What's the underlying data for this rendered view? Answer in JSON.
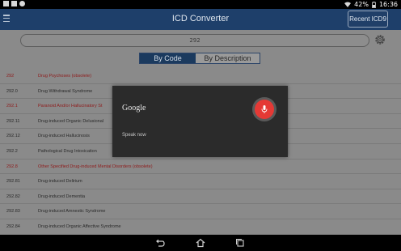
{
  "status_bar": {
    "battery": "42%",
    "time": "16:36",
    "icons": [
      "usb-icon",
      "notification-icon",
      "android-icon",
      "wifi-icon",
      "battery-icon"
    ]
  },
  "app_bar": {
    "title": "ICD Converter",
    "recent_button": "Recent ICD9",
    "menu_icon": "menu-icon"
  },
  "search": {
    "value": "292"
  },
  "tabs": [
    {
      "label": "By Code",
      "active": true
    },
    {
      "label": "By Description",
      "active": false
    }
  ],
  "rows": [
    {
      "code": "292",
      "desc": "Drug Psychoses  (obsolete)",
      "obsolete": true
    },
    {
      "code": "292.0",
      "desc": "Drug Withdrawal Syndrome",
      "obsolete": false
    },
    {
      "code": "292.1",
      "desc": "Paranoid And/or Hallucinatory St",
      "obsolete": true
    },
    {
      "code": "292.11",
      "desc": "Drug-induced Organic Delusional",
      "obsolete": false
    },
    {
      "code": "292.12",
      "desc": "Drug-induced Hallucinosis",
      "obsolete": false
    },
    {
      "code": "292.2",
      "desc": "Pathological Drug Intoxication",
      "obsolete": false
    },
    {
      "code": "292.8",
      "desc": "Other Specified Drug-induced Mental Disorders  (obsolete)",
      "obsolete": true
    },
    {
      "code": "292.81",
      "desc": "Drug-induced Delirium",
      "obsolete": false
    },
    {
      "code": "292.82",
      "desc": "Drug-induced Dementia",
      "obsolete": false
    },
    {
      "code": "292.83",
      "desc": "Drug-induced Amnestic Syndrome",
      "obsolete": false
    },
    {
      "code": "292.84",
      "desc": "Drug-induced Organic Affective Syndrome",
      "obsolete": false
    }
  ],
  "voice_dialog": {
    "brand": "Google",
    "prompt": "Speak now",
    "mic_color": "#e53935"
  },
  "colors": {
    "app_bar": "#1e3f6a",
    "obsolete_text": "#8e1a1a"
  },
  "nav_icons": [
    "back-icon",
    "home-icon",
    "recents-icon"
  ]
}
